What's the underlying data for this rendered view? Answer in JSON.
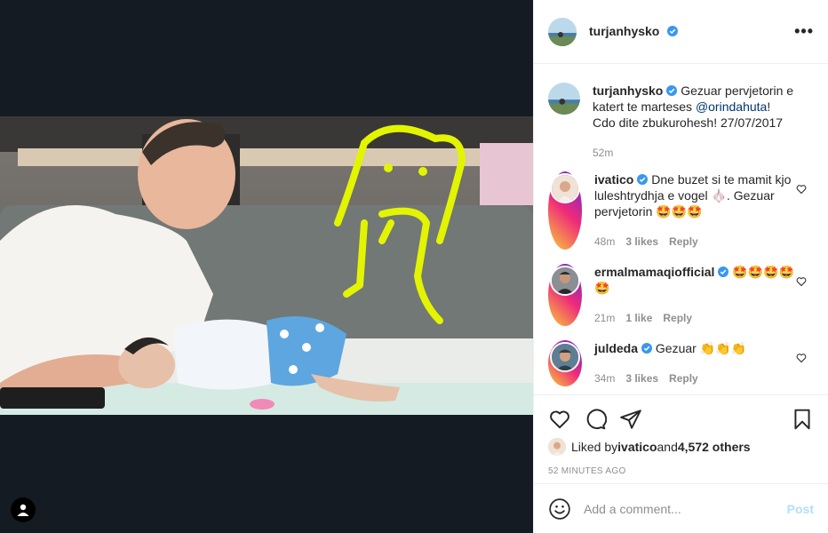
{
  "post": {
    "author": "turjanhysko",
    "caption": "Gezuar pervjetorin e katert te marteses ",
    "caption_mention": "@orindahuta",
    "caption_rest": "! Cdo dite zbukurohesh! 27/07/2017",
    "caption_time": "52m"
  },
  "comments": [
    {
      "username": "ivatico",
      "verified": true,
      "text": "Dne buzet si te mamit kjo luleshtrydhja e vogel 🧄. Gezuar pervjetorin 🤩🤩🤩",
      "time": "48m",
      "likes": "3 likes",
      "reply": "Reply"
    },
    {
      "username": "ermalmamaqiofficial",
      "verified": true,
      "text": "🤩🤩🤩🤩🤩",
      "time": "21m",
      "likes": "1 like",
      "reply": "Reply"
    },
    {
      "username": "juldeda",
      "verified": true,
      "text": "Gezuar 👏👏👏",
      "time": "34m",
      "likes": "3 likes",
      "reply": "Reply"
    }
  ],
  "likes": {
    "prefix": "Liked by ",
    "user": "ivatico",
    "middle": " and ",
    "count": "4,572 others"
  },
  "timestamp": "52 MINUTES AGO",
  "comment_box": {
    "placeholder": "Add a comment...",
    "post_label": "Post"
  },
  "colors": {
    "accent": "#0095f6",
    "verified": "#3897f0",
    "post_disabled": "#b2dffc"
  }
}
